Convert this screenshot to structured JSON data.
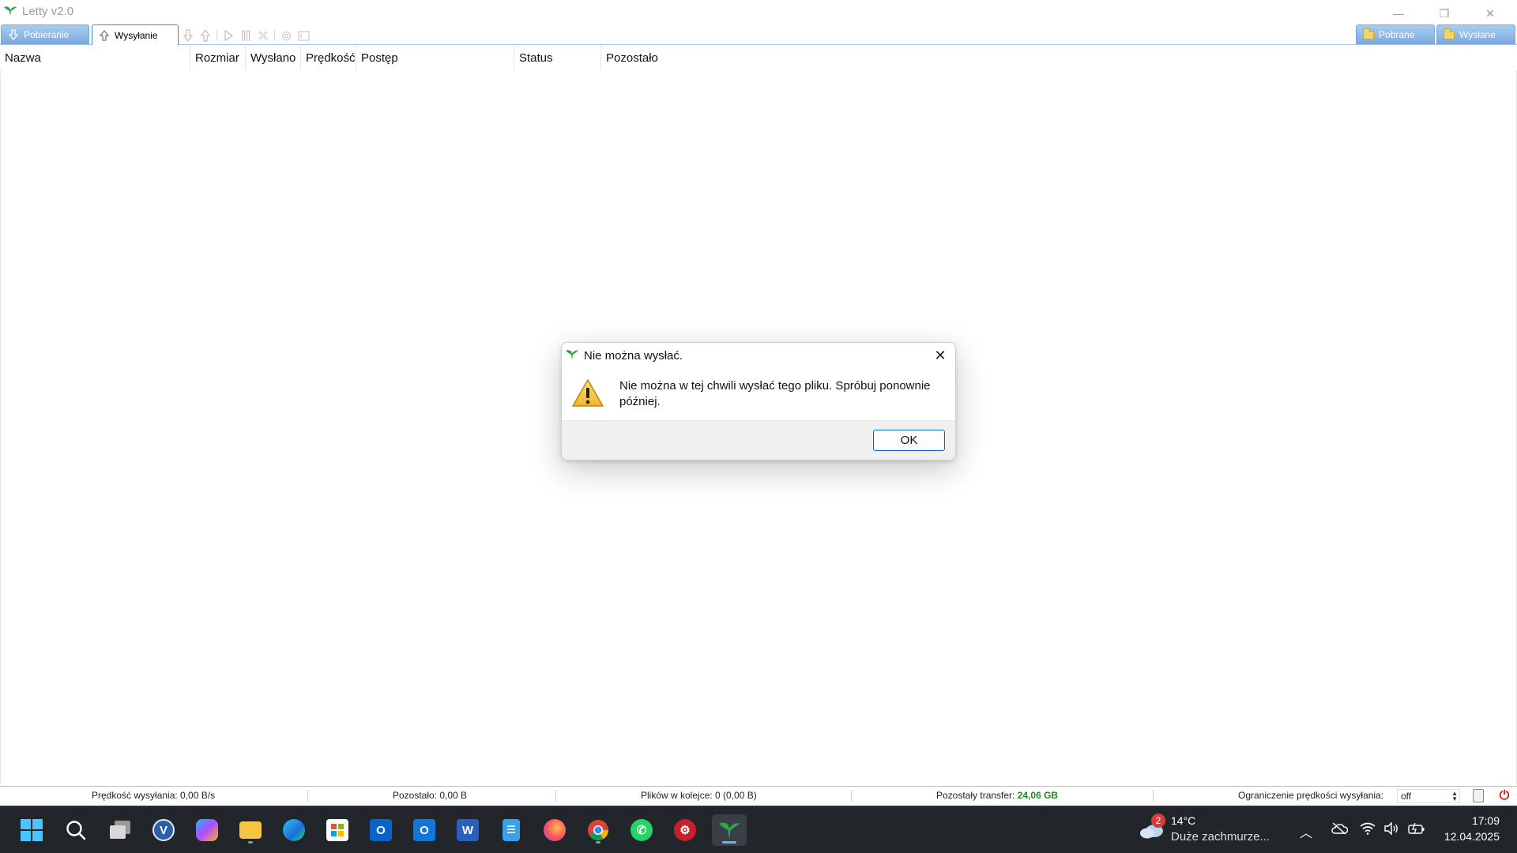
{
  "window": {
    "title": "Letty v2.0",
    "minimize_glyph": "—",
    "maximize_glyph": "❐",
    "close_glyph": "✕"
  },
  "tabs": {
    "download_label": "Pobieranie",
    "upload_label": "Wysyłanie",
    "downloaded_label": "Pobrane",
    "sent_label": "Wysłane",
    "active": "upload"
  },
  "toolbar": {
    "icons": [
      "download-icon",
      "upload-icon",
      "play-icon",
      "pause-icon",
      "cancel-icon",
      "settings-icon",
      "info-icon"
    ]
  },
  "columns": [
    "Nazwa",
    "Rozmiar",
    "Wysłano",
    "Prędkość",
    "Postęp",
    "Status",
    "Pozostało"
  ],
  "statusbar": {
    "upload_speed": "Prędkość wysyłania: 0,00 B/s",
    "remaining": "Pozostało: 0,00 B",
    "queue": "Plików w kolejce: 0 (0,00 B)",
    "transfer_label": "Pozostały transfer:",
    "transfer_value": "24,06 GB",
    "limit_label": "Ograniczenie prędkości wysyłania:",
    "limit_value": "off"
  },
  "dialog": {
    "title": "Nie można wysłać.",
    "message": "Nie można w tej chwili wysłać tego pliku. Spróbuj ponownie później.",
    "ok_label": "OK",
    "close_glyph": "✕"
  },
  "taskbar": {
    "weather_badge": "2",
    "weather_temp": "14°C",
    "weather_desc": "Duże zachmurze...",
    "time": "17:09",
    "date": "12.04.2025",
    "apps": [
      "start",
      "search",
      "task-view",
      "vpn",
      "copilot",
      "file-explorer",
      "edge",
      "store",
      "outlook",
      "outlook-new",
      "word",
      "notepad",
      "firefox",
      "chrome",
      "whatsapp",
      "security-app",
      "letty"
    ]
  },
  "colors": {
    "accent_tab": "#7aa9dc",
    "transfer_value": "#1e8a1e",
    "ok_border": "#0a64c8",
    "taskbar_bg": "#22262b"
  }
}
